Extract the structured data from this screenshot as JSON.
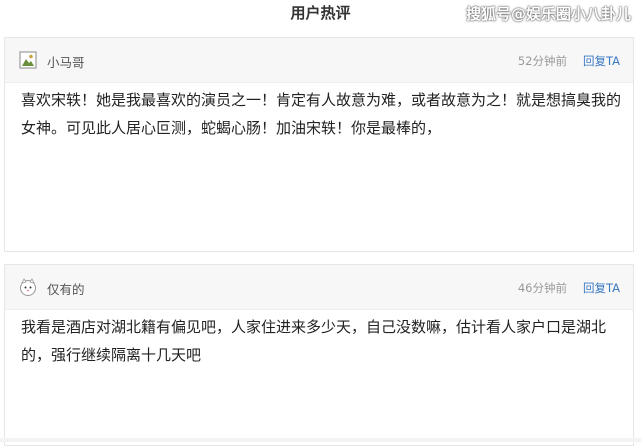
{
  "header": {
    "title": "用户热评",
    "watermark": "搜狐号@娱乐圈小八卦儿"
  },
  "comments": [
    {
      "username": "小马哥",
      "avatar_icon": "user-avatar-icon",
      "time": "52分钟前",
      "reply_label": "回复TA",
      "text": "喜欢宋轶！她是我最喜欢的演员之一！肯定有人故意为难，或者故意为之！就是想搞臭我的女神。可见此人居心叵测，蛇蝎心肠！加油宋轶！你是最棒的，"
    },
    {
      "username": "仅有的",
      "avatar_icon": "cat-avatar-icon",
      "time": "46分钟前",
      "reply_label": "回复TA",
      "text": "我看是酒店对湖北籍有偏见吧，人家住进来多少天，自己没数嘛，估计看人家户口是湖北的，强行继续隔离十几天吧"
    }
  ]
}
